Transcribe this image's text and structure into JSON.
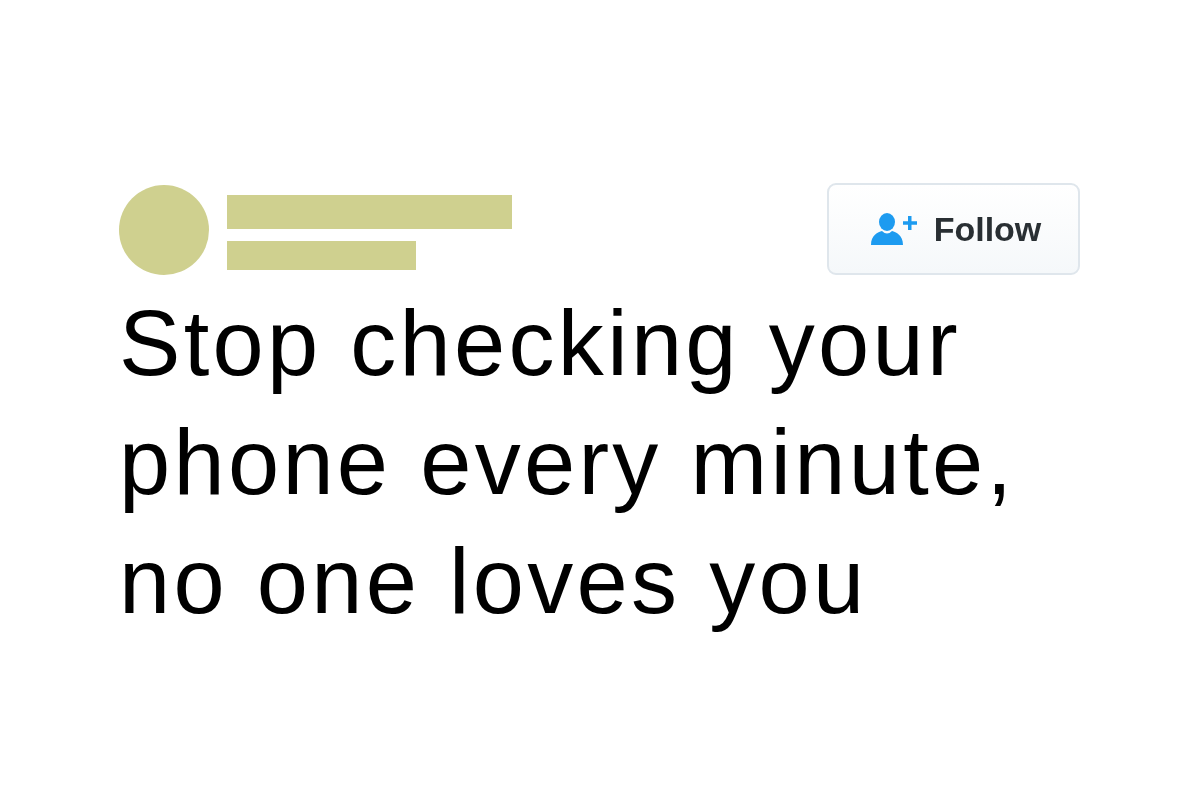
{
  "post": {
    "follow_button": {
      "label": "Follow"
    },
    "text": "Stop checking your phone every minute, no one loves you"
  }
}
